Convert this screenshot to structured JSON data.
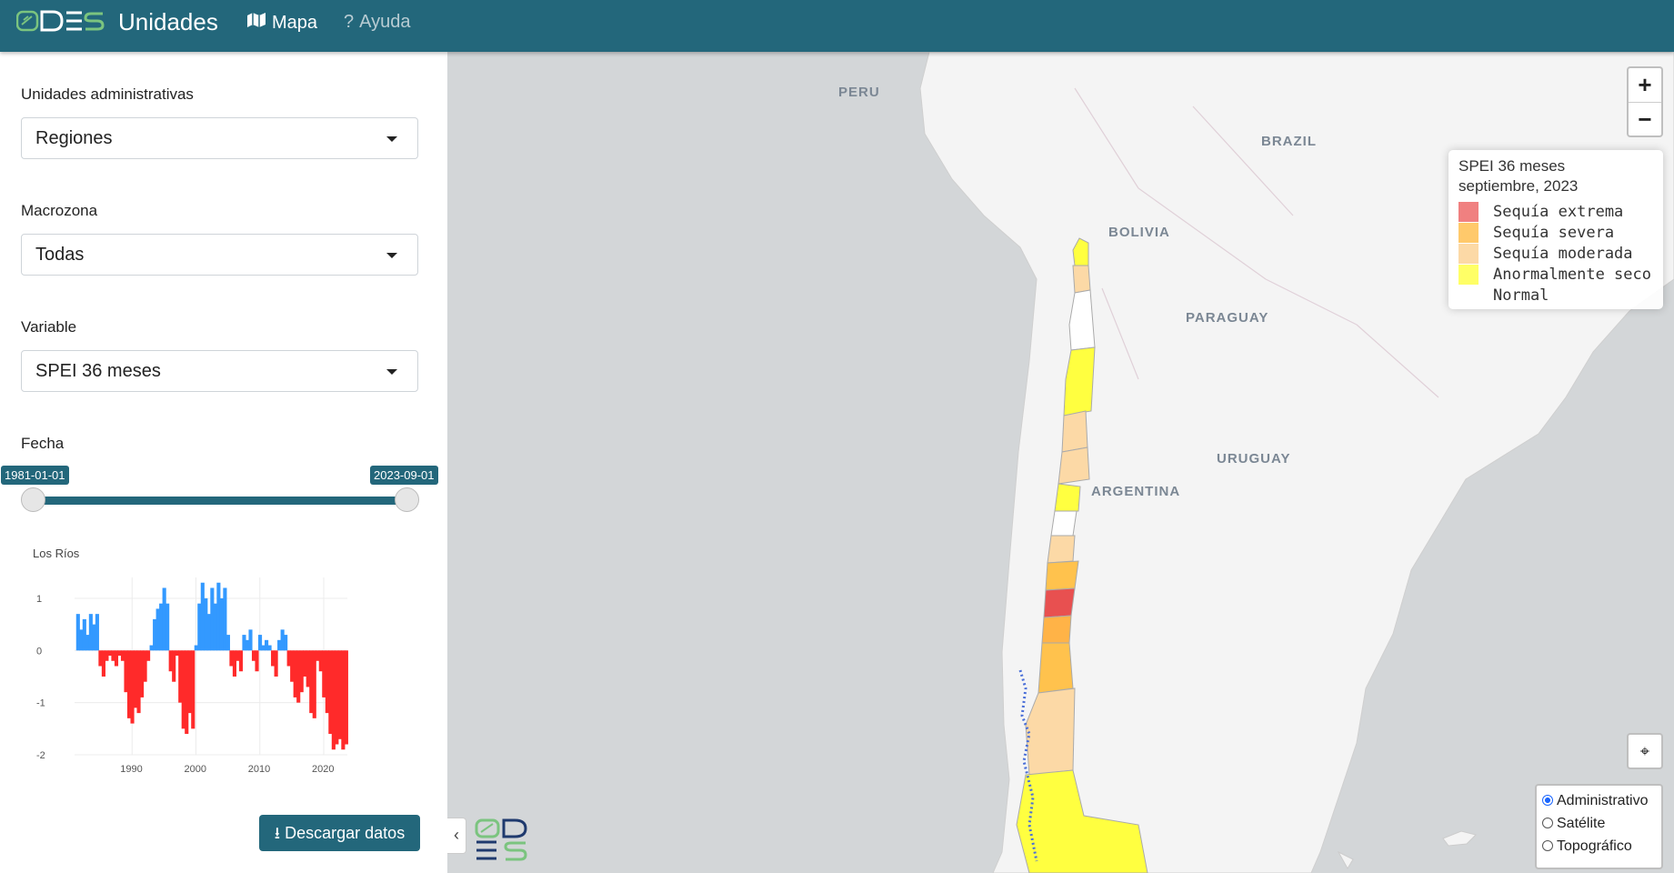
{
  "navbar": {
    "brand_logo": "ODES logo",
    "title": "Unidades",
    "nav": [
      {
        "label": "Mapa",
        "icon": "map-icon"
      },
      {
        "label": "Ayuda",
        "icon": "question-icon"
      }
    ]
  },
  "sidebar": {
    "admin_label": "Unidades administrativas",
    "admin_value": "Regiones",
    "macro_label": "Macrozona",
    "macro_value": "Todas",
    "variable_label": "Variable",
    "variable_value": "SPEI 36 meses",
    "fecha_label": "Fecha",
    "date_start": "1981-01-01",
    "date_end": "2023-09-01",
    "download_label": "Descargar datos",
    "download_icon": "download-icon"
  },
  "chart_data": {
    "type": "area",
    "title": "Los Ríos",
    "x_ticks": [
      "1990",
      "2000",
      "2010",
      "2020"
    ],
    "y_ticks": [
      "1",
      "0",
      "-1",
      "-2"
    ],
    "ylim": [
      -2,
      1.4
    ],
    "xlim": [
      1981,
      2023.7
    ],
    "positive_color": "#3399ff",
    "negative_color": "#ff2a2a",
    "x": [
      1981.5,
      1982,
      1982.5,
      1983,
      1983.5,
      1984,
      1984.5,
      1985,
      1985.5,
      1986,
      1986.5,
      1987,
      1987.5,
      1988,
      1988.5,
      1989,
      1989.5,
      1990,
      1990.5,
      1991,
      1991.5,
      1992,
      1992.5,
      1993,
      1993.5,
      1994,
      1994.5,
      1995,
      1995.5,
      1996,
      1996.5,
      1997,
      1997.5,
      1998,
      1998.5,
      1999,
      1999.5,
      2000,
      2000.5,
      2001,
      2001.5,
      2002,
      2002.5,
      2003,
      2003.5,
      2004,
      2004.5,
      2005,
      2005.5,
      2006,
      2006.5,
      2007,
      2007.5,
      2008,
      2008.5,
      2009,
      2009.5,
      2010,
      2010.5,
      2011,
      2011.5,
      2012,
      2012.5,
      2013,
      2013.5,
      2014,
      2014.5,
      2015,
      2015.5,
      2016,
      2016.5,
      2017,
      2017.5,
      2018,
      2018.5,
      2019,
      2019.5,
      2020,
      2020.5,
      2021,
      2021.5,
      2022,
      2022.5,
      2023,
      2023.5
    ],
    "y": [
      0.7,
      0.4,
      0.6,
      0.3,
      0.7,
      0.5,
      0.7,
      -0.3,
      -0.5,
      -0.2,
      -0.1,
      -0.2,
      -0.3,
      -0.1,
      -0.2,
      -0.8,
      -1.3,
      -1.4,
      -1.1,
      -1.2,
      -0.9,
      -0.6,
      -0.2,
      0.1,
      0.6,
      0.8,
      0.9,
      1.2,
      0.9,
      -0.4,
      -0.6,
      -0.1,
      -1.0,
      -1.5,
      -1.6,
      -1.2,
      -1.5,
      0.1,
      0.9,
      1.3,
      1.0,
      0.7,
      1.2,
      0.9,
      1.3,
      1.0,
      1.2,
      0.3,
      -0.3,
      -0.5,
      -0.2,
      -0.4,
      0.3,
      0.2,
      0.4,
      -0.2,
      -0.4,
      0.3,
      0.1,
      0.2,
      0.1,
      -0.3,
      -0.5,
      0.2,
      0.4,
      0.3,
      -0.3,
      -0.6,
      -0.9,
      -1.0,
      -0.8,
      -0.5,
      -0.7,
      -1.2,
      -1.3,
      -0.2,
      -0.4,
      -0.9,
      -1.2,
      -1.6,
      -1.9,
      -1.8,
      -1.7,
      -1.9,
      -1.8
    ]
  },
  "map": {
    "labels": [
      "PERU",
      "BRAZIL",
      "BOLIVIA",
      "PARAGUAY",
      "URUGUAY",
      "ARGENTINA"
    ],
    "zoom_in": "+",
    "zoom_out": "−",
    "locate_icon": "crosshair-icon",
    "legend": {
      "title": "SPEI 36 meses",
      "subtitle": "septiembre, 2023",
      "items": [
        {
          "label": "Sequía extrema",
          "color": "#f08080"
        },
        {
          "label": "Sequía severa",
          "color": "#ffc96b"
        },
        {
          "label": "Sequía moderada",
          "color": "#fcd9a6"
        },
        {
          "label": "Anormalmente seco",
          "color": "#ffff66"
        },
        {
          "label": "Normal",
          "color": "#ffffff"
        }
      ]
    },
    "layers": [
      {
        "label": "Administrativo",
        "selected": true
      },
      {
        "label": "Satélite",
        "selected": false
      },
      {
        "label": "Topográfico",
        "selected": false
      }
    ]
  }
}
